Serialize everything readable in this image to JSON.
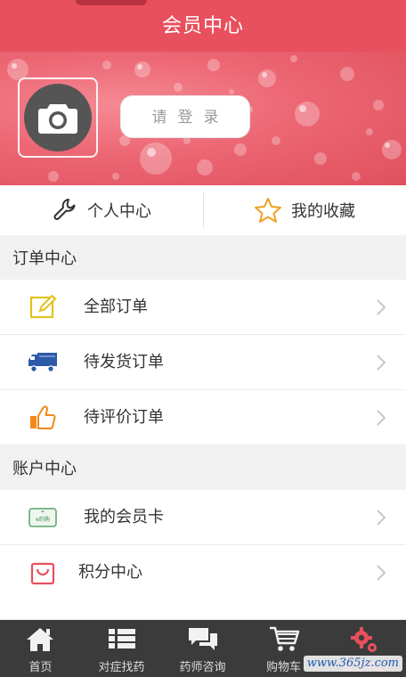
{
  "header": {
    "title": "会员中心"
  },
  "profile": {
    "avatar_icon": "camera-icon",
    "login_label": "请登录"
  },
  "quick_links": [
    {
      "label": "个人中心",
      "icon": "wrench-icon"
    },
    {
      "label": "我的收藏",
      "icon": "star-icon"
    }
  ],
  "orders": {
    "title": "订单中心",
    "items": [
      {
        "label": "全部订单",
        "icon": "edit-note-icon"
      },
      {
        "label": "待发货订单",
        "icon": "delivery-truck-icon"
      },
      {
        "label": "待评价订单",
        "icon": "thumbs-up-icon"
      }
    ]
  },
  "account": {
    "title": "账户中心",
    "items": [
      {
        "label": "我的会员卡",
        "icon": "member-card-icon",
        "card_text": "e约购"
      },
      {
        "label": "积分中心",
        "icon": "shopping-bag-icon"
      }
    ]
  },
  "tabbar": [
    {
      "label": "首页",
      "icon": "home-icon"
    },
    {
      "label": "对症找药",
      "icon": "list-icon"
    },
    {
      "label": "药师咨询",
      "icon": "chat-icon"
    },
    {
      "label": "购物车",
      "icon": "cart-icon"
    },
    {
      "label": "会员中心",
      "icon": "gears-icon",
      "active": true
    }
  ],
  "watermark": "www.365jz.com",
  "colors": {
    "accent": "#e8505e",
    "tabbar_bg": "#3b3b3b"
  }
}
